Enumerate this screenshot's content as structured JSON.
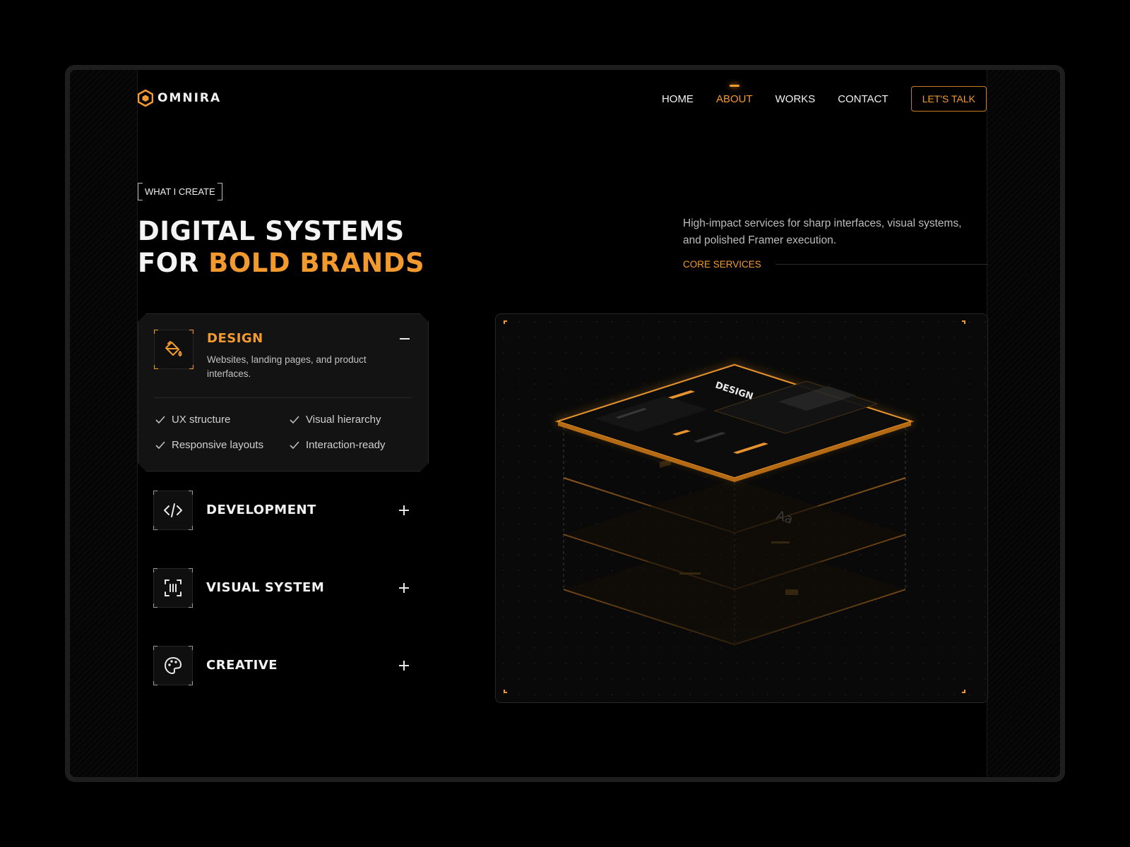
{
  "brand": {
    "name": "OMNIRA"
  },
  "nav": {
    "items": [
      {
        "label": "HOME",
        "active": false
      },
      {
        "label": "ABOUT",
        "active": true
      },
      {
        "label": "WORKS",
        "active": false
      },
      {
        "label": "CONTACT",
        "active": false
      }
    ],
    "cta_label": "LET'S TALK"
  },
  "hero": {
    "tag": "WHAT I CREATE",
    "headline_line1": "DIGITAL SYSTEMS",
    "headline_line2_prefix": "FOR ",
    "headline_line2_accent": "BOLD BRANDS",
    "intro": "High-impact services for sharp interfaces, visual systems, and polished Framer execution.",
    "core_label": "CORE SERVICES"
  },
  "services": [
    {
      "title": "DESIGN",
      "expanded": true,
      "icon": "paint-bucket-icon",
      "description": "Websites, landing pages, and product interfaces.",
      "features": [
        "UX structure",
        "Visual hierarchy",
        "Responsive layouts",
        "Interaction-ready"
      ]
    },
    {
      "title": "DEVELOPMENT",
      "expanded": false,
      "icon": "code-icon"
    },
    {
      "title": "VISUAL SYSTEM",
      "expanded": false,
      "icon": "scan-bars-icon"
    },
    {
      "title": "CREATIVE",
      "expanded": false,
      "icon": "palette-icon"
    }
  ],
  "panel": {
    "mock_title": "DESIGN",
    "mock_glyph": "Aa"
  },
  "colors": {
    "accent": "#f39a2e",
    "background": "#000000",
    "card": "#131313"
  }
}
